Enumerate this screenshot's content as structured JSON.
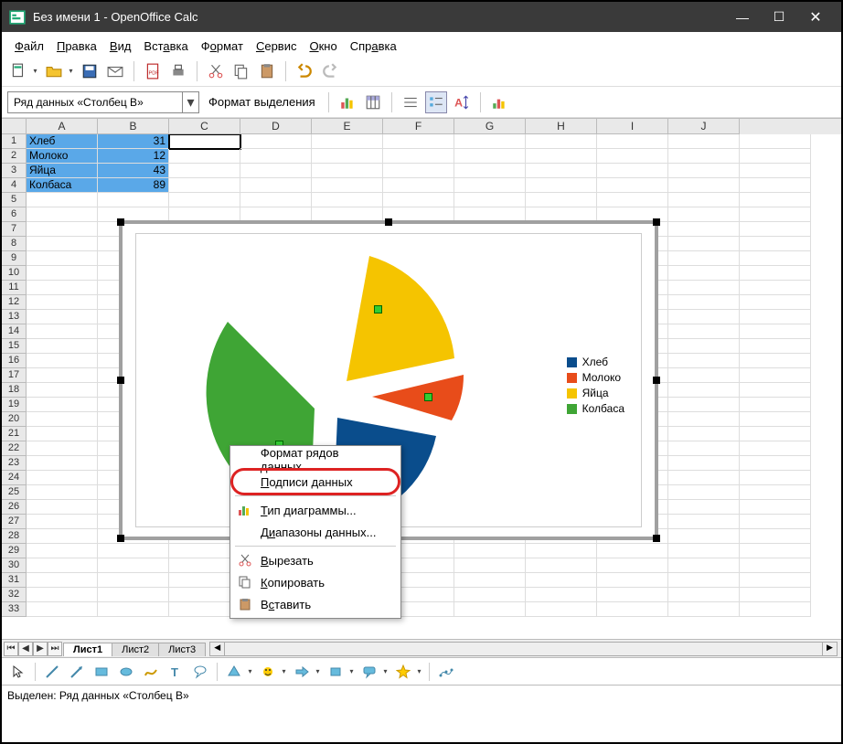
{
  "window": {
    "title": "Без имени 1 - OpenOffice Calc"
  },
  "menu": {
    "file": "Файл",
    "edit": "Правка",
    "view": "Вид",
    "insert": "Вставка",
    "format": "Формат",
    "tools": "Сервис",
    "window": "Окно",
    "help": "Справка"
  },
  "formula_bar": {
    "name_box": "Ряд данных «Столбец B»",
    "format_selection": "Формат выделения"
  },
  "columns": [
    "A",
    "B",
    "C",
    "D",
    "E",
    "F",
    "G",
    "H",
    "I",
    "J"
  ],
  "data_rows": [
    {
      "row": 1,
      "a": "Хлеб",
      "b": "31"
    },
    {
      "row": 2,
      "a": "Молоко",
      "b": "12"
    },
    {
      "row": 3,
      "a": "Яйца",
      "b": "43"
    },
    {
      "row": 4,
      "a": "Колбаса",
      "b": "89"
    }
  ],
  "chart_data": {
    "type": "pie",
    "categories": [
      "Хлеб",
      "Молоко",
      "Яйца",
      "Колбаса"
    ],
    "values": [
      31,
      12,
      43,
      89
    ],
    "colors": [
      "#0a4d8c",
      "#e84c1a",
      "#f5c400",
      "#3fa535"
    ],
    "legend": [
      {
        "label": "Хлеб",
        "color": "#0a4d8c"
      },
      {
        "label": "Молоко",
        "color": "#e84c1a"
      },
      {
        "label": "Яйца",
        "color": "#f5c400"
      },
      {
        "label": "Колбаса",
        "color": "#3fa535"
      }
    ]
  },
  "context_menu": {
    "format_series": "Формат рядов данных...",
    "data_labels": "Подписи данных",
    "chart_type": "Тип диаграммы...",
    "data_ranges": "Диапазоны данных...",
    "cut": "Вырезать",
    "copy": "Копировать",
    "paste": "Вставить"
  },
  "sheet_tabs": {
    "sheet1": "Лист1",
    "sheet2": "Лист2",
    "sheet3": "Лист3"
  },
  "status_bar": {
    "text": "Выделен: Ряд данных «Столбец B»"
  }
}
